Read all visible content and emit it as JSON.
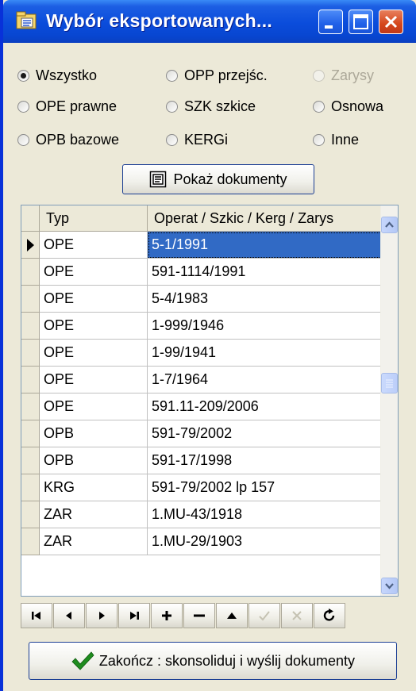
{
  "window": {
    "title": "Wybór eksportowanych...",
    "controls": [
      "minimize",
      "maximize",
      "close"
    ]
  },
  "filters": [
    {
      "label": "Wszystko",
      "checked": true,
      "disabled": false
    },
    {
      "label": "OPP przejśc.",
      "checked": false,
      "disabled": false
    },
    {
      "label": "Zarysy",
      "checked": false,
      "disabled": true
    },
    {
      "label": "OPE prawne",
      "checked": false,
      "disabled": false
    },
    {
      "label": "SZK szkice",
      "checked": false,
      "disabled": false
    },
    {
      "label": "Osnowa",
      "checked": false,
      "disabled": false
    },
    {
      "label": "OPB bazowe",
      "checked": false,
      "disabled": false
    },
    {
      "label": "KERGi",
      "checked": false,
      "disabled": false
    },
    {
      "label": "Inne",
      "checked": false,
      "disabled": false
    }
  ],
  "show_button": {
    "label": "Pokaż dokumenty",
    "icon": "document-view-icon"
  },
  "grid": {
    "columns": [
      "Typ",
      "Operat / Szkic / Kerg / Zarys"
    ],
    "rows": [
      {
        "typ": "OPE",
        "operat": "5-1/1991"
      },
      {
        "typ": "OPE",
        "operat": "591-1114/1991"
      },
      {
        "typ": "OPE",
        "operat": "5-4/1983"
      },
      {
        "typ": "OPE",
        "operat": "1-999/1946"
      },
      {
        "typ": "OPE",
        "operat": "1-99/1941"
      },
      {
        "typ": "OPE",
        "operat": "1-7/1964"
      },
      {
        "typ": "OPE",
        "operat": "591.11-209/2006"
      },
      {
        "typ": "OPB",
        "operat": "591-79/2002"
      },
      {
        "typ": "OPB",
        "operat": "591-17/1998"
      },
      {
        "typ": "KRG",
        "operat": "591-79/2002 lp 157"
      },
      {
        "typ": "ZAR",
        "operat": "1.MU-43/1918"
      },
      {
        "typ": "ZAR",
        "operat": "1.MU-29/1903"
      }
    ],
    "selected_row": 0
  },
  "navigator": [
    "first-icon",
    "prior-icon",
    "next-icon",
    "last-icon",
    "insert-icon",
    "delete-icon",
    "edit-icon",
    "post-icon",
    "cancel-icon",
    "refresh-icon"
  ],
  "finish_button": {
    "label": "Zakończ : skonsoliduj i wyślij dokumenty",
    "icon": "checkmark-icon"
  },
  "colors": {
    "titlebar": "#0A4CDB",
    "selection": "#316AC5",
    "face": "#ECE9D8",
    "close": "#D5461B",
    "check": "#1E8C1E"
  }
}
